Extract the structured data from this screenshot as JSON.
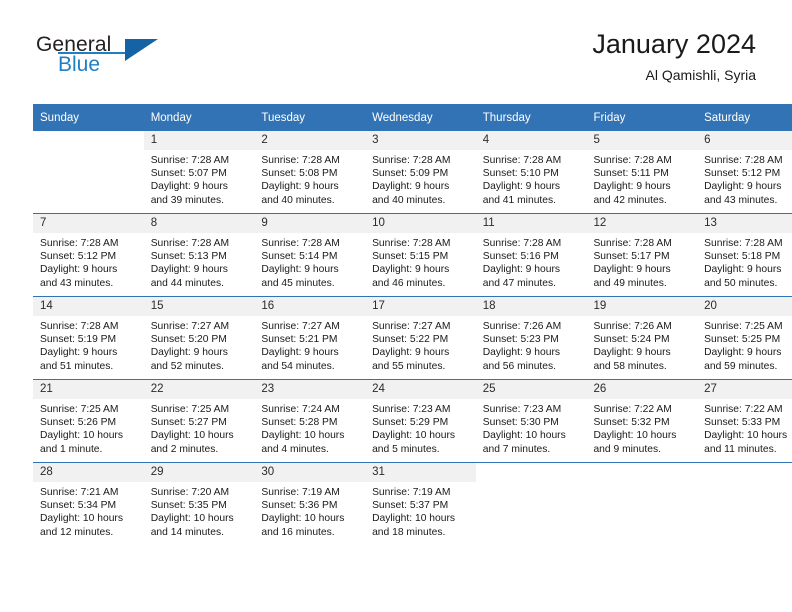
{
  "brand": {
    "name_part1": "General",
    "name_part2": "Blue",
    "logo_icon": "triangle-icon",
    "accent_color": "#1f7fc4",
    "header_color": "#3273b5"
  },
  "header": {
    "month_title": "January 2024",
    "location": "Al Qamishli, Syria"
  },
  "calendar": {
    "weekday_headers": [
      "Sunday",
      "Monday",
      "Tuesday",
      "Wednesday",
      "Thursday",
      "Friday",
      "Saturday"
    ],
    "weeks": [
      [
        {
          "day": "",
          "empty": true,
          "sunrise": "",
          "sunset": "",
          "daylight_line1": "",
          "daylight_line2": ""
        },
        {
          "day": "1",
          "sunrise": "Sunrise: 7:28 AM",
          "sunset": "Sunset: 5:07 PM",
          "daylight_line1": "Daylight: 9 hours",
          "daylight_line2": "and 39 minutes."
        },
        {
          "day": "2",
          "sunrise": "Sunrise: 7:28 AM",
          "sunset": "Sunset: 5:08 PM",
          "daylight_line1": "Daylight: 9 hours",
          "daylight_line2": "and 40 minutes."
        },
        {
          "day": "3",
          "sunrise": "Sunrise: 7:28 AM",
          "sunset": "Sunset: 5:09 PM",
          "daylight_line1": "Daylight: 9 hours",
          "daylight_line2": "and 40 minutes."
        },
        {
          "day": "4",
          "sunrise": "Sunrise: 7:28 AM",
          "sunset": "Sunset: 5:10 PM",
          "daylight_line1": "Daylight: 9 hours",
          "daylight_line2": "and 41 minutes."
        },
        {
          "day": "5",
          "sunrise": "Sunrise: 7:28 AM",
          "sunset": "Sunset: 5:11 PM",
          "daylight_line1": "Daylight: 9 hours",
          "daylight_line2": "and 42 minutes."
        },
        {
          "day": "6",
          "sunrise": "Sunrise: 7:28 AM",
          "sunset": "Sunset: 5:12 PM",
          "daylight_line1": "Daylight: 9 hours",
          "daylight_line2": "and 43 minutes."
        }
      ],
      [
        {
          "day": "7",
          "sunrise": "Sunrise: 7:28 AM",
          "sunset": "Sunset: 5:12 PM",
          "daylight_line1": "Daylight: 9 hours",
          "daylight_line2": "and 43 minutes."
        },
        {
          "day": "8",
          "sunrise": "Sunrise: 7:28 AM",
          "sunset": "Sunset: 5:13 PM",
          "daylight_line1": "Daylight: 9 hours",
          "daylight_line2": "and 44 minutes."
        },
        {
          "day": "9",
          "sunrise": "Sunrise: 7:28 AM",
          "sunset": "Sunset: 5:14 PM",
          "daylight_line1": "Daylight: 9 hours",
          "daylight_line2": "and 45 minutes."
        },
        {
          "day": "10",
          "sunrise": "Sunrise: 7:28 AM",
          "sunset": "Sunset: 5:15 PM",
          "daylight_line1": "Daylight: 9 hours",
          "daylight_line2": "and 46 minutes."
        },
        {
          "day": "11",
          "sunrise": "Sunrise: 7:28 AM",
          "sunset": "Sunset: 5:16 PM",
          "daylight_line1": "Daylight: 9 hours",
          "daylight_line2": "and 47 minutes."
        },
        {
          "day": "12",
          "sunrise": "Sunrise: 7:28 AM",
          "sunset": "Sunset: 5:17 PM",
          "daylight_line1": "Daylight: 9 hours",
          "daylight_line2": "and 49 minutes."
        },
        {
          "day": "13",
          "sunrise": "Sunrise: 7:28 AM",
          "sunset": "Sunset: 5:18 PM",
          "daylight_line1": "Daylight: 9 hours",
          "daylight_line2": "and 50 minutes."
        }
      ],
      [
        {
          "day": "14",
          "sunrise": "Sunrise: 7:28 AM",
          "sunset": "Sunset: 5:19 PM",
          "daylight_line1": "Daylight: 9 hours",
          "daylight_line2": "and 51 minutes."
        },
        {
          "day": "15",
          "sunrise": "Sunrise: 7:27 AM",
          "sunset": "Sunset: 5:20 PM",
          "daylight_line1": "Daylight: 9 hours",
          "daylight_line2": "and 52 minutes."
        },
        {
          "day": "16",
          "sunrise": "Sunrise: 7:27 AM",
          "sunset": "Sunset: 5:21 PM",
          "daylight_line1": "Daylight: 9 hours",
          "daylight_line2": "and 54 minutes."
        },
        {
          "day": "17",
          "sunrise": "Sunrise: 7:27 AM",
          "sunset": "Sunset: 5:22 PM",
          "daylight_line1": "Daylight: 9 hours",
          "daylight_line2": "and 55 minutes."
        },
        {
          "day": "18",
          "sunrise": "Sunrise: 7:26 AM",
          "sunset": "Sunset: 5:23 PM",
          "daylight_line1": "Daylight: 9 hours",
          "daylight_line2": "and 56 minutes."
        },
        {
          "day": "19",
          "sunrise": "Sunrise: 7:26 AM",
          "sunset": "Sunset: 5:24 PM",
          "daylight_line1": "Daylight: 9 hours",
          "daylight_line2": "and 58 minutes."
        },
        {
          "day": "20",
          "sunrise": "Sunrise: 7:25 AM",
          "sunset": "Sunset: 5:25 PM",
          "daylight_line1": "Daylight: 9 hours",
          "daylight_line2": "and 59 minutes."
        }
      ],
      [
        {
          "day": "21",
          "sunrise": "Sunrise: 7:25 AM",
          "sunset": "Sunset: 5:26 PM",
          "daylight_line1": "Daylight: 10 hours",
          "daylight_line2": "and 1 minute."
        },
        {
          "day": "22",
          "sunrise": "Sunrise: 7:25 AM",
          "sunset": "Sunset: 5:27 PM",
          "daylight_line1": "Daylight: 10 hours",
          "daylight_line2": "and 2 minutes."
        },
        {
          "day": "23",
          "sunrise": "Sunrise: 7:24 AM",
          "sunset": "Sunset: 5:28 PM",
          "daylight_line1": "Daylight: 10 hours",
          "daylight_line2": "and 4 minutes."
        },
        {
          "day": "24",
          "sunrise": "Sunrise: 7:23 AM",
          "sunset": "Sunset: 5:29 PM",
          "daylight_line1": "Daylight: 10 hours",
          "daylight_line2": "and 5 minutes."
        },
        {
          "day": "25",
          "sunrise": "Sunrise: 7:23 AM",
          "sunset": "Sunset: 5:30 PM",
          "daylight_line1": "Daylight: 10 hours",
          "daylight_line2": "and 7 minutes."
        },
        {
          "day": "26",
          "sunrise": "Sunrise: 7:22 AM",
          "sunset": "Sunset: 5:32 PM",
          "daylight_line1": "Daylight: 10 hours",
          "daylight_line2": "and 9 minutes."
        },
        {
          "day": "27",
          "sunrise": "Sunrise: 7:22 AM",
          "sunset": "Sunset: 5:33 PM",
          "daylight_line1": "Daylight: 10 hours",
          "daylight_line2": "and 11 minutes."
        }
      ],
      [
        {
          "day": "28",
          "sunrise": "Sunrise: 7:21 AM",
          "sunset": "Sunset: 5:34 PM",
          "daylight_line1": "Daylight: 10 hours",
          "daylight_line2": "and 12 minutes."
        },
        {
          "day": "29",
          "sunrise": "Sunrise: 7:20 AM",
          "sunset": "Sunset: 5:35 PM",
          "daylight_line1": "Daylight: 10 hours",
          "daylight_line2": "and 14 minutes."
        },
        {
          "day": "30",
          "sunrise": "Sunrise: 7:19 AM",
          "sunset": "Sunset: 5:36 PM",
          "daylight_line1": "Daylight: 10 hours",
          "daylight_line2": "and 16 minutes."
        },
        {
          "day": "31",
          "sunrise": "Sunrise: 7:19 AM",
          "sunset": "Sunset: 5:37 PM",
          "daylight_line1": "Daylight: 10 hours",
          "daylight_line2": "and 18 minutes."
        },
        {
          "day": "",
          "empty": true,
          "sunrise": "",
          "sunset": "",
          "daylight_line1": "",
          "daylight_line2": ""
        },
        {
          "day": "",
          "empty": true,
          "sunrise": "",
          "sunset": "",
          "daylight_line1": "",
          "daylight_line2": ""
        },
        {
          "day": "",
          "empty": true,
          "sunrise": "",
          "sunset": "",
          "daylight_line1": "",
          "daylight_line2": ""
        }
      ]
    ]
  }
}
